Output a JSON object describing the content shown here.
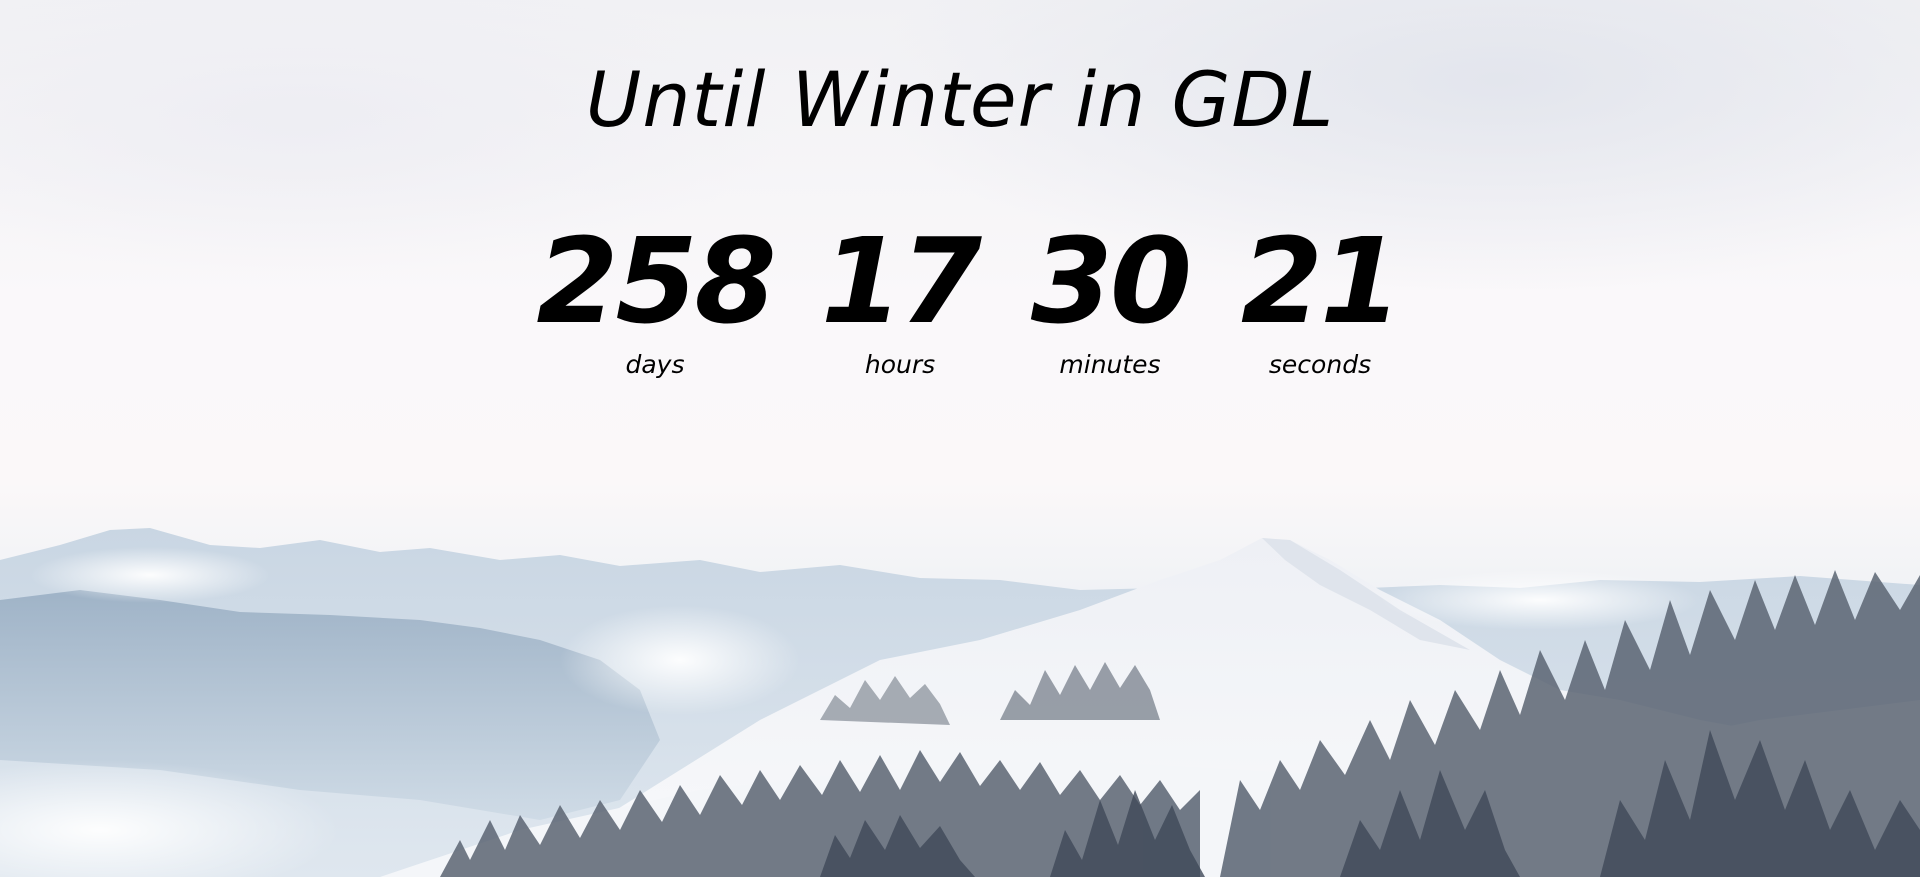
{
  "title": "Until Winter in GDL",
  "countdown": [
    {
      "value": "258",
      "unit": "days"
    },
    {
      "value": "17",
      "unit": "hours"
    },
    {
      "value": "30",
      "unit": "minutes"
    },
    {
      "value": "21",
      "unit": "seconds"
    }
  ],
  "background": {
    "scene": "snowy mountains with pine trees",
    "text_color": "#000000",
    "sky_color": "#f8f6f8",
    "snow_color": "#ffffff",
    "tree_color": "#5a6472"
  }
}
